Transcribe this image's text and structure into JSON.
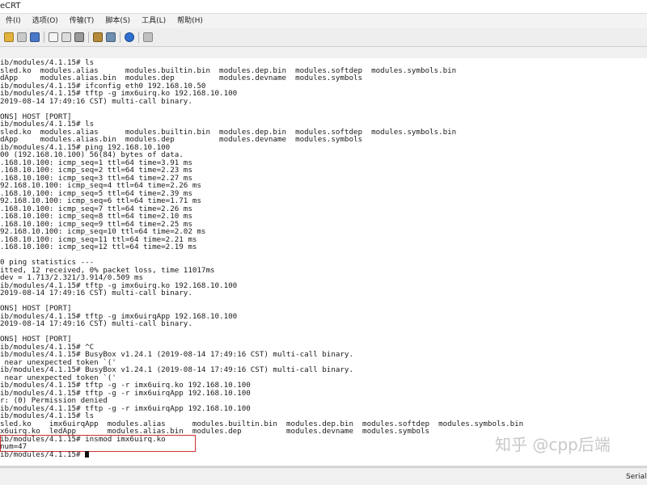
{
  "window": {
    "title": "eCRT"
  },
  "menu": [
    "件(I)",
    "选项(O)",
    "传输(T)",
    "脚本(S)",
    "工具(L)",
    "帮助(H)"
  ],
  "toolbar_icons": [
    "connect-icon",
    "reconnect-icon",
    "find-icon",
    "copy-icon",
    "paste-icon",
    "print-icon",
    "settings-icon",
    "tools-icon",
    "help-icon",
    "map-icon"
  ],
  "terminal": {
    "lines": [
      "ib/modules/4.1.15# ls",
      "sled.ko  modules.alias      modules.builtin.bin  modules.dep.bin  modules.softdep  modules.symbols.bin",
      "dApp     modules.alias.bin  modules.dep          modules.devname  modules.symbols",
      "ib/modules/4.1.15# ifconfig eth0 192.168.10.50",
      "ib/modules/4.1.15# tftp -g imx6uirq.ko 192.168.10.100",
      "2019-08-14 17:49:16 CST) multi-call binary.",
      "",
      "ONS] HOST [PORT]",
      "ib/modules/4.1.15# ls",
      "sled.ko  modules.alias      modules.builtin.bin  modules.dep.bin  modules.softdep  modules.symbols.bin",
      "dApp     modules.alias.bin  modules.dep          modules.devname  modules.symbols",
      "ib/modules/4.1.15# ping 192.168.10.100",
      "00 (192.168.10.100) 56(84) bytes of data.",
      ".168.10.100: icmp_seq=1 ttl=64 time=3.91 ms",
      ".168.10.100: icmp_seq=2 ttl=64 time=2.23 ms",
      ".168.10.100: icmp_seq=3 ttl=64 time=2.27 ms",
      "92.168.10.100: icmp_seq=4 ttl=64 time=2.26 ms",
      ".168.10.100: icmp_seq=5 ttl=64 time=2.39 ms",
      "92.168.10.100: icmp_seq=6 ttl=64 time=1.71 ms",
      ".168.10.100: icmp_seq=7 ttl=64 time=2.26 ms",
      ".168.10.100: icmp_seq=8 ttl=64 time=2.10 ms",
      ".168.10.100: icmp_seq=9 ttl=64 time=2.25 ms",
      "92.168.10.100: icmp_seq=10 ttl=64 time=2.02 ms",
      ".168.10.100: icmp_seq=11 ttl=64 time=2.21 ms",
      ".168.10.100: icmp_seq=12 ttl=64 time=2.19 ms",
      "",
      "0 ping statistics ---",
      "itted, 12 received, 0% packet loss, time 11017ms",
      "dev = 1.713/2.321/3.914/0.509 ms",
      "ib/modules/4.1.15# tftp -g imx6uirq.ko 192.168.10.100",
      "2019-08-14 17:49:16 CST) multi-call binary.",
      "",
      "ONS] HOST [PORT]",
      "ib/modules/4.1.15# tftp -g imx6uirqApp 192.168.10.100",
      "2019-08-14 17:49:16 CST) multi-call binary.",
      "",
      "ONS] HOST [PORT]",
      "ib/modules/4.1.15# ^C",
      "ib/modules/4.1.15# BusyBox v1.24.1 (2019-08-14 17:49:16 CST) multi-call binary.",
      " near unexpected token `('",
      "ib/modules/4.1.15# BusyBox v1.24.1 (2019-08-14 17:49:16 CST) multi-call binary.",
      " near unexpected token `('",
      "ib/modules/4.1.15# tftp -g -r imx6uirq.ko 192.168.10.100",
      "ib/modules/4.1.15# tftp -g -r imx6uirqApp 192.168.10.100",
      "r: (0) Permission denied",
      "ib/modules/4.1.15# tftp -g -r imx6uirqApp 192.168.10.100",
      "ib/modules/4.1.15# ls",
      "sled.ko    imx6uirqApp  modules.alias      modules.builtin.bin  modules.dep.bin  modules.softdep  modules.symbols.bin",
      "x6uirq.ko  ledApp       modules.alias.bin  modules.dep          modules.devname  modules.symbols",
      "ib/modules/4.1.15# insmod imx6uirq.ko",
      "num=47",
      "ib/modules/4.1.15# "
    ]
  },
  "watermark": "知乎 @cpp后端",
  "status": {
    "text": "Serial"
  }
}
